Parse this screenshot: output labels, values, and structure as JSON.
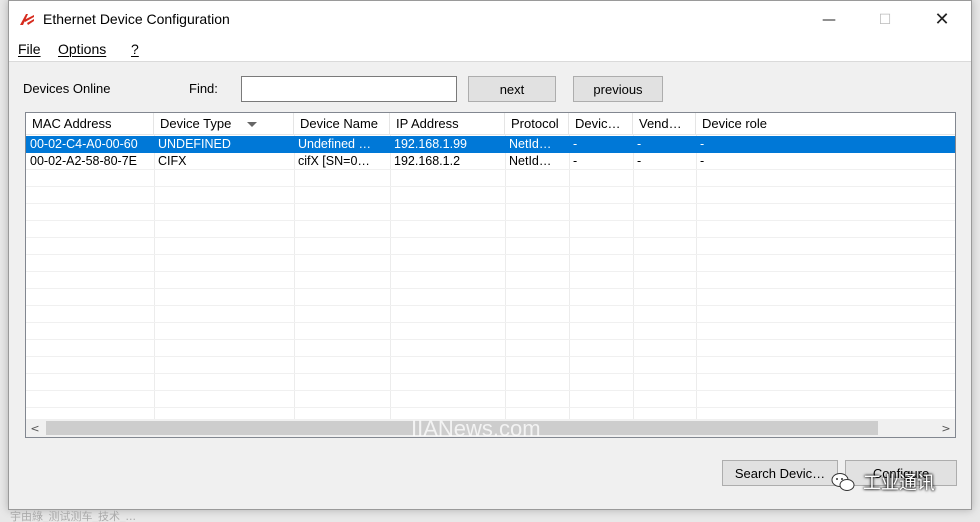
{
  "window": {
    "title": "Ethernet Device Configuration",
    "controls": {
      "minimize": "—",
      "maximize": "☐",
      "close": "✕"
    }
  },
  "menu": [
    "File",
    "Options",
    "?"
  ],
  "toolbar": {
    "devices_online_label": "Devices Online",
    "find_label": "Find:",
    "find_value": "",
    "next_label": "next",
    "previous_label": "previous"
  },
  "table": {
    "columns": [
      "MAC Address",
      "Device Type",
      "Device Name",
      "IP Address",
      "Protocol",
      "Devic…",
      "Vend…",
      "Device role"
    ],
    "rows": [
      [
        "00-02-C4-A0-00-60",
        "UNDEFINED",
        "Undefined …",
        "192.168.1.99",
        "NetId…",
        "-",
        "-",
        "-"
      ],
      [
        "00-02-A2-58-80-7E",
        "CIFX",
        "cifX [SN=0…",
        "192.168.1.2",
        "NetId…",
        "-",
        "-",
        "-"
      ]
    ],
    "selected_row": 0
  },
  "buttons": {
    "search_devices": "Search Devic…",
    "configure": "Configure"
  },
  "overlays": {
    "watermark": "IIANews.com",
    "brand": "工业通讯"
  },
  "background": {
    "taskbar_text": "宇由綠_测试测车_技术_..."
  },
  "colors": {
    "selection": "#0078d7",
    "window_bg": "#f0f0f0"
  }
}
